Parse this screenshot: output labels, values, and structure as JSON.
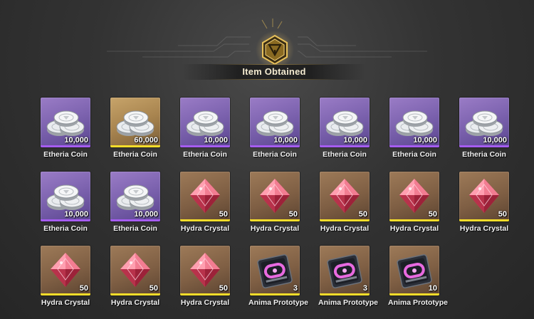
{
  "header": {
    "title": "Item Obtained"
  },
  "colors": {
    "rarity_purple": "#a55cf0",
    "rarity_gold": "#f6dd2a",
    "accent": "#e8c15a"
  },
  "items": [
    {
      "name": "Etheria Coin",
      "qty": "10,000",
      "icon": "coin-stack-icon",
      "rarity": "purple"
    },
    {
      "name": "Etheria Coin",
      "qty": "60,000",
      "icon": "coin-stack-icon",
      "rarity": "gold"
    },
    {
      "name": "Etheria Coin",
      "qty": "10,000",
      "icon": "coin-stack-icon",
      "rarity": "purple"
    },
    {
      "name": "Etheria Coin",
      "qty": "10,000",
      "icon": "coin-stack-icon",
      "rarity": "purple"
    },
    {
      "name": "Etheria Coin",
      "qty": "10,000",
      "icon": "coin-stack-icon",
      "rarity": "purple"
    },
    {
      "name": "Etheria Coin",
      "qty": "10,000",
      "icon": "coin-stack-icon",
      "rarity": "purple"
    },
    {
      "name": "Etheria Coin",
      "qty": "10,000",
      "icon": "coin-stack-icon",
      "rarity": "purple"
    },
    {
      "name": "Etheria Coin",
      "qty": "10,000",
      "icon": "coin-stack-icon",
      "rarity": "purple"
    },
    {
      "name": "Etheria Coin",
      "qty": "10,000",
      "icon": "coin-stack-icon",
      "rarity": "purple"
    },
    {
      "name": "Hydra Crystal",
      "qty": "50",
      "icon": "crystal-icon",
      "rarity": "brown"
    },
    {
      "name": "Hydra Crystal",
      "qty": "50",
      "icon": "crystal-icon",
      "rarity": "brown"
    },
    {
      "name": "Hydra Crystal",
      "qty": "50",
      "icon": "crystal-icon",
      "rarity": "brown"
    },
    {
      "name": "Hydra Crystal",
      "qty": "50",
      "icon": "crystal-icon",
      "rarity": "brown"
    },
    {
      "name": "Hydra Crystal",
      "qty": "50",
      "icon": "crystal-icon",
      "rarity": "brown"
    },
    {
      "name": "Hydra Crystal",
      "qty": "50",
      "icon": "crystal-icon",
      "rarity": "brown"
    },
    {
      "name": "Hydra Crystal",
      "qty": "50",
      "icon": "crystal-icon",
      "rarity": "brown"
    },
    {
      "name": "Hydra Crystal",
      "qty": "50",
      "icon": "crystal-icon",
      "rarity": "brown"
    },
    {
      "name": "Anima Prototype",
      "qty": "3",
      "icon": "module-chip-icon",
      "rarity": "brown"
    },
    {
      "name": "Anima Prototype",
      "qty": "3",
      "icon": "module-chip-icon",
      "rarity": "brown"
    },
    {
      "name": "Anima Prototype",
      "qty": "10",
      "icon": "module-chip-icon",
      "rarity": "brown"
    }
  ]
}
